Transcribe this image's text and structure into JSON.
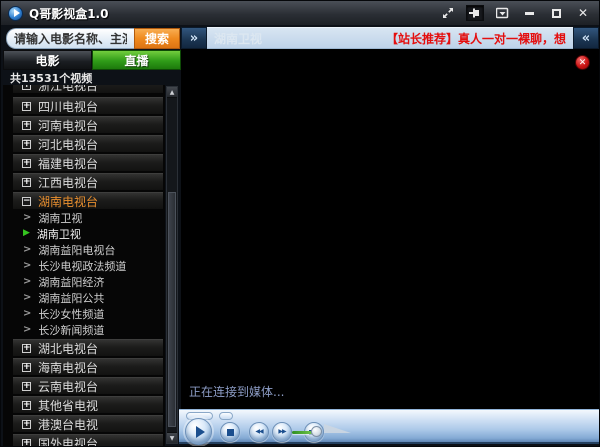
{
  "window": {
    "title": "Q哥影视盒1.0"
  },
  "icons": {
    "plus": "+",
    "minus": "−",
    "chevron": ">",
    "play_indicator": "▶",
    "scroll_up": "▲",
    "scroll_down": "▼",
    "panel_expand": "»",
    "panel_collapse": "«",
    "ad_close": "✕",
    "win_close": "✕",
    "skip_prev": "◀◀",
    "skip_next": "▶▶"
  },
  "sidebar": {
    "search": {
      "value": "请输入电影名称、主演",
      "button_label": "搜索"
    },
    "tabs": [
      {
        "label": "电影"
      },
      {
        "label": "直播"
      }
    ],
    "count_label": "共13531个视频",
    "channels": [
      {
        "label": "浙江电视台",
        "kind": "group",
        "state": "collapsed-partial"
      },
      {
        "label": "四川电视台",
        "kind": "group",
        "state": "collapsed"
      },
      {
        "label": "河南电视台",
        "kind": "group",
        "state": "collapsed"
      },
      {
        "label": "河北电视台",
        "kind": "group",
        "state": "collapsed"
      },
      {
        "label": "福建电视台",
        "kind": "group",
        "state": "collapsed"
      },
      {
        "label": "江西电视台",
        "kind": "group",
        "state": "collapsed"
      },
      {
        "label": "湖南电视台",
        "kind": "group",
        "state": "expanded"
      },
      {
        "label": "湖南卫视",
        "kind": "sub",
        "state": "normal"
      },
      {
        "label": "湖南卫视",
        "kind": "sub",
        "state": "playing"
      },
      {
        "label": "湖南益阳电视台",
        "kind": "sub",
        "state": "normal"
      },
      {
        "label": "长沙电视政法频道",
        "kind": "sub",
        "state": "normal"
      },
      {
        "label": "湖南益阳经济",
        "kind": "sub",
        "state": "normal"
      },
      {
        "label": "湖南益阳公共",
        "kind": "sub",
        "state": "normal"
      },
      {
        "label": "长沙女性频道",
        "kind": "sub",
        "state": "normal"
      },
      {
        "label": "长沙新闻频道",
        "kind": "sub",
        "state": "normal"
      },
      {
        "label": "湖北电视台",
        "kind": "group",
        "state": "collapsed"
      },
      {
        "label": "海南电视台",
        "kind": "group",
        "state": "collapsed"
      },
      {
        "label": "云南电视台",
        "kind": "group",
        "state": "collapsed"
      },
      {
        "label": "其他省电视",
        "kind": "group",
        "state": "collapsed"
      },
      {
        "label": "港澳台电视",
        "kind": "group",
        "state": "collapsed"
      },
      {
        "label": "国外电视台",
        "kind": "group",
        "state": "collapsed"
      }
    ]
  },
  "video": {
    "channel_title": "湖南卫视",
    "promo_text": "【站长推荐】真人一对一裸聊，想",
    "status_text": "正在连接到媒体..."
  },
  "colors": {
    "accent_orange": "#ef8a1f",
    "live_green": "#2f9c18",
    "promo_red": "#e40f0f",
    "playing_green": "#35c520",
    "expanded_group_orange": "#e88f2f"
  }
}
